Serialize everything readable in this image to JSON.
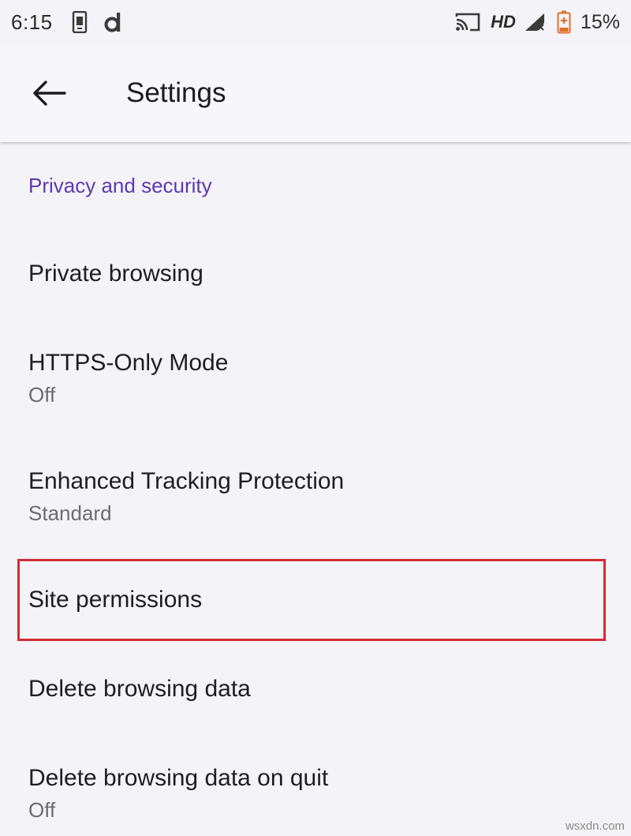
{
  "status_bar": {
    "time": "6:15",
    "network_label": "HD",
    "battery_percent": "15%",
    "icons": [
      "phone-screen-icon",
      "d-app-icon",
      "cast-icon",
      "signal-icon",
      "battery-icon"
    ]
  },
  "app_bar": {
    "title": "Settings",
    "back_icon": "arrow-back-icon"
  },
  "section": {
    "header": "Privacy and security"
  },
  "items": [
    {
      "title": "Private browsing",
      "summary": ""
    },
    {
      "title": "HTTPS-Only Mode",
      "summary": "Off"
    },
    {
      "title": "Enhanced Tracking Protection",
      "summary": "Standard"
    },
    {
      "title": "Site permissions",
      "summary": ""
    },
    {
      "title": "Delete browsing data",
      "summary": ""
    },
    {
      "title": "Delete browsing data on quit",
      "summary": "Off"
    }
  ],
  "highlighted_item": "Site permissions",
  "watermark": "wsxdn.com",
  "colors": {
    "section_accent": "#5b3bb0",
    "highlight": "#d42b33",
    "background": "#f4f3f8",
    "battery_low": "#e0702a"
  }
}
